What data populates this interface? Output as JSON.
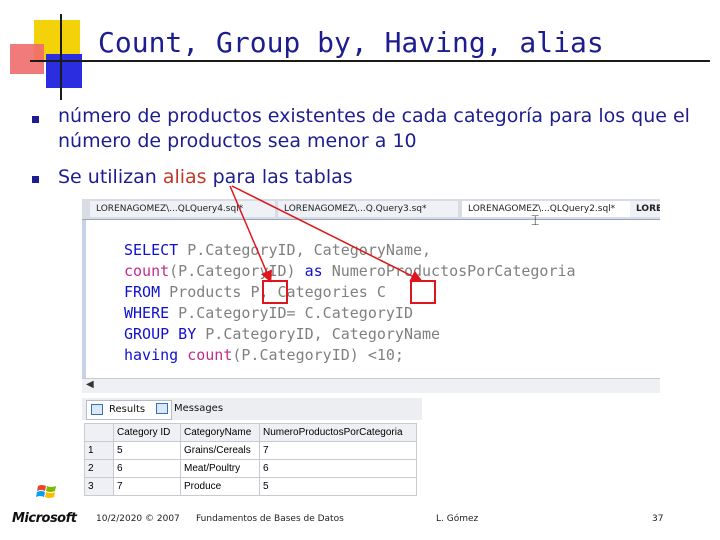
{
  "slide": {
    "title": "Count,  Group by, Having, alias",
    "bullets": [
      "número de productos existentes de cada categoría para los que el número de productos sea menor a 10",
      "Se utilizan alias para las tablas"
    ],
    "bullet2_prefix": "Se utilizan ",
    "bullet2_highlight": "alias",
    "bullet2_suffix": " para las tablas"
  },
  "editor": {
    "tabs": [
      {
        "label": "LORENAGOMEZ\\...QLQuery4.sql*"
      },
      {
        "label": "LORENAGOMEZ\\...Q.Query3.sq*"
      },
      {
        "label": "LORENAGOMEZ\\...QLQuery2.sql*"
      },
      {
        "label": "LORE"
      }
    ],
    "code": {
      "l1_kw": "SELECT",
      "l1_rest": " P.CategoryID, CategoryName,",
      "l2_fn": "count",
      "l2_rest": "(P.CategoryID) ",
      "l2_as": "as",
      "l2_alias": " NumeroProductosPorCategoria",
      "l3_kw": "FROM",
      "l3_a": " Products ",
      "l3_p": "P",
      "l3_b": ", Categories ",
      "l3_c": "C",
      "l4_kw": "WHERE",
      "l4_rest": " P.CategoryID= C.CategoryID",
      "l5_kw": "GROUP BY",
      "l5_rest": " P.CategoryID, CategoryName",
      "l6_kw": "having",
      "l6_fn": " count",
      "l6_a": "(P.CategoryID) ",
      "l6_b": "<10;"
    }
  },
  "results": {
    "tabs": [
      "Results",
      "Messages"
    ],
    "columns": [
      "Category ID",
      "CategoryName",
      "NumeroProductosPorCategoria"
    ],
    "rows": [
      {
        "n": "1",
        "id": "5",
        "name": "Grains/Cereals",
        "count": "7"
      },
      {
        "n": "2",
        "id": "6",
        "name": "Meat/Poultry",
        "count": "6"
      },
      {
        "n": "3",
        "id": "7",
        "name": "Produce",
        "count": "5"
      }
    ]
  },
  "footer": {
    "logo": "Microsoft",
    "date": "10/2/2020 © 2007",
    "course": "Fundamentos de Bases de Datos",
    "author": "L. Gómez",
    "page": "37"
  },
  "colors": {
    "title": "#1d1d8f",
    "keyword": "#1010d0",
    "function": "#c42c8a",
    "highlight_box": "#e0141c",
    "accent_yellow": "#f4d20a",
    "accent_blue": "#2b2ee0",
    "accent_red": "#f06b6b"
  }
}
